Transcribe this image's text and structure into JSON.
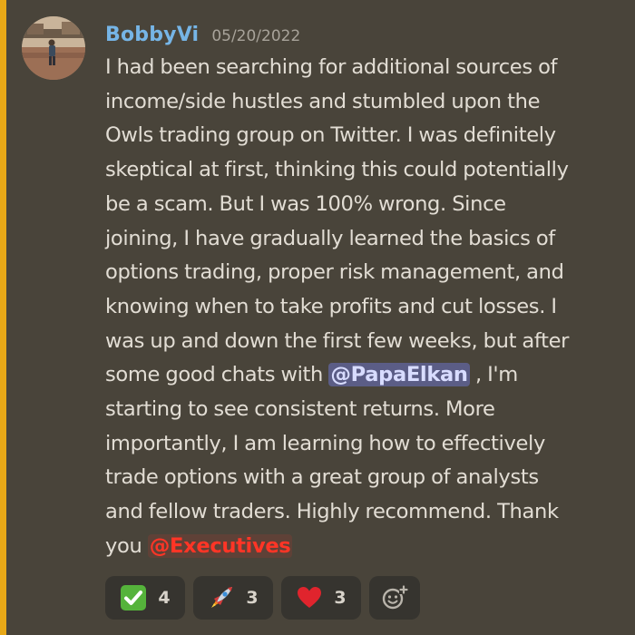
{
  "message": {
    "author": "BobbyVi",
    "timestamp": "05/20/2022",
    "author_color": "#76b5e6",
    "accent_color": "#e8a817",
    "lines": [
      "I had been searching for additional sources of",
      "income/side hustles and stumbled upon the",
      "Owls trading group on Twitter. I was definitely",
      "skeptical at first, thinking this could potentially",
      "be a scam. But I was 100% wrong. Since",
      "joining, I have gradually learned the basics of",
      "options trading, proper risk management, and",
      "knowing when to take profits and cut losses. I",
      "was up and down the first few weeks, but after"
    ],
    "line10_prefix": "some good chats with ",
    "user_mention": "@PapaElkan",
    "line10_suffix": " , I'm",
    "lines_after": [
      "starting to see consistent returns. More",
      "importantly, I am learning how to effectively",
      "trade options with a great group of analysts",
      "and fellow traders. Highly recommend. Thank"
    ],
    "last_line_prefix": "you ",
    "role_mention": "@Executives",
    "role_mention_color": "#ff3526"
  },
  "reactions": [
    {
      "emoji": "check-mark-icon",
      "count": "4"
    },
    {
      "emoji": "rocket-icon",
      "count": "3"
    },
    {
      "emoji": "heart-icon",
      "count": "3"
    },
    {
      "emoji": "add-reaction-icon"
    }
  ]
}
